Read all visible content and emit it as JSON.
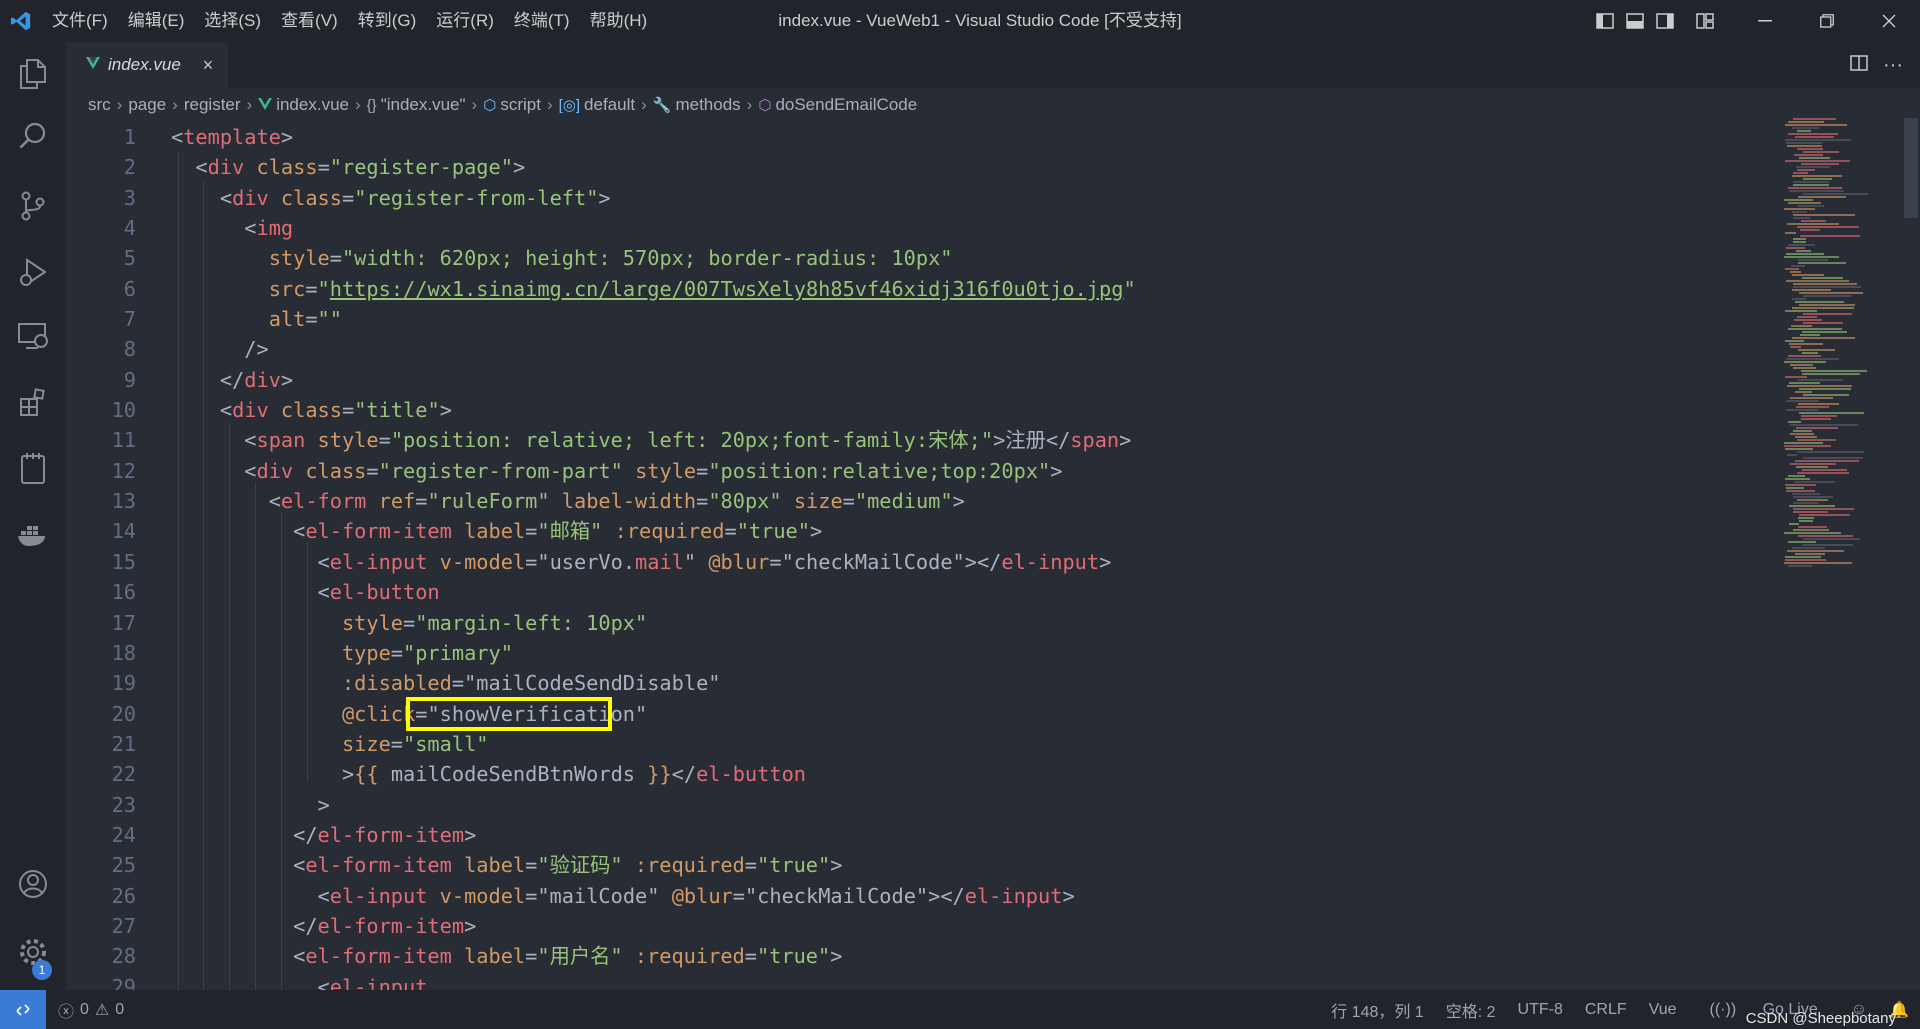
{
  "titlebar": {
    "menu": [
      "文件(F)",
      "编辑(E)",
      "选择(S)",
      "查看(V)",
      "转到(G)",
      "运行(R)",
      "终端(T)",
      "帮助(H)"
    ],
    "title": "index.vue - VueWeb1 - Visual Studio Code [不受支持]"
  },
  "tab": {
    "label": "index.vue",
    "close": "×"
  },
  "breadcrumb": {
    "items": [
      {
        "label": "src",
        "icon": ""
      },
      {
        "label": "page",
        "icon": ""
      },
      {
        "label": "register",
        "icon": ""
      },
      {
        "label": "index.vue",
        "icon": "vue-icon"
      },
      {
        "label": "\"index.vue\"",
        "icon": "braces-icon"
      },
      {
        "label": "script",
        "icon": "cube-icon"
      },
      {
        "label": "default",
        "icon": "module-icon"
      },
      {
        "label": "methods",
        "icon": "wrench-icon"
      },
      {
        "label": "doSendEmailCode",
        "icon": "method-icon"
      }
    ]
  },
  "editor": {
    "line_numbers": [
      "1",
      "2",
      "3",
      "4",
      "5",
      "6",
      "7",
      "8",
      "9",
      "10",
      "11",
      "12",
      "13",
      "14",
      "15",
      "16",
      "17",
      "18",
      "19",
      "20",
      "21",
      "22",
      "23",
      "24",
      "25",
      "26",
      "27",
      "28",
      "29"
    ],
    "highlighted_text": "\"showVerification\"",
    "highlight_color": "#ffff00"
  },
  "activity": {
    "badge": "1"
  },
  "statusbar": {
    "errors": "0",
    "warnings": "0",
    "position": "行 148，列 1",
    "spaces": "空格: 2",
    "encoding": "UTF-8",
    "eol": "CRLF",
    "language": "Vue",
    "golive": "Go Live",
    "watermark": "CSDN @Sheepbotany"
  },
  "colors": {
    "accent": "#3a7bd5",
    "tag": "#e06c75",
    "attr": "#d19a66",
    "string": "#98c379"
  }
}
